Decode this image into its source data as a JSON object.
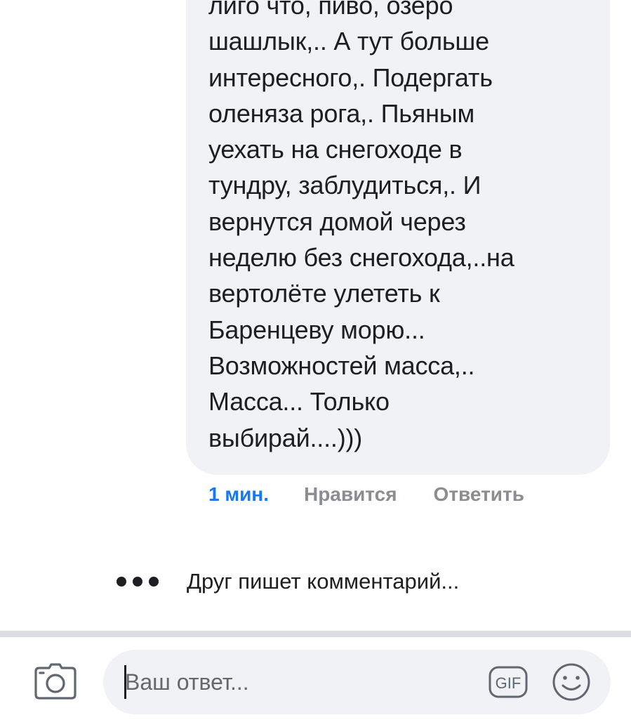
{
  "comment": {
    "text": "лиго что, пиво, озеро\nшашлык,.. А тут больше\nинтересного,. Подергать\nоленяза рога,. Пьяным\nуехать на снегоходе в\nтундру, заблудиться,. И\nвернутся домой через\nнеделю без снегохода,..на\nвертолёте улететь к\nБаренцеву морю...\nВозможностей масса,..\nМасса... Только\nвыбирай....)))",
    "time": "1 мин.",
    "like_label": "Нравится",
    "reply_label": "Ответить"
  },
  "typing": {
    "text": "Друг пишет комментарий..."
  },
  "composer": {
    "placeholder": "Ваш ответ...",
    "gif_label": "GIF",
    "camera_icon": "camera-icon",
    "emoji_icon": "smiley-icon"
  },
  "colors": {
    "bubble_bg": "#f0f2f5",
    "accent": "#1877f2",
    "muted": "#8a8d91",
    "text": "#1c1e21",
    "divider": "#dadde1"
  }
}
